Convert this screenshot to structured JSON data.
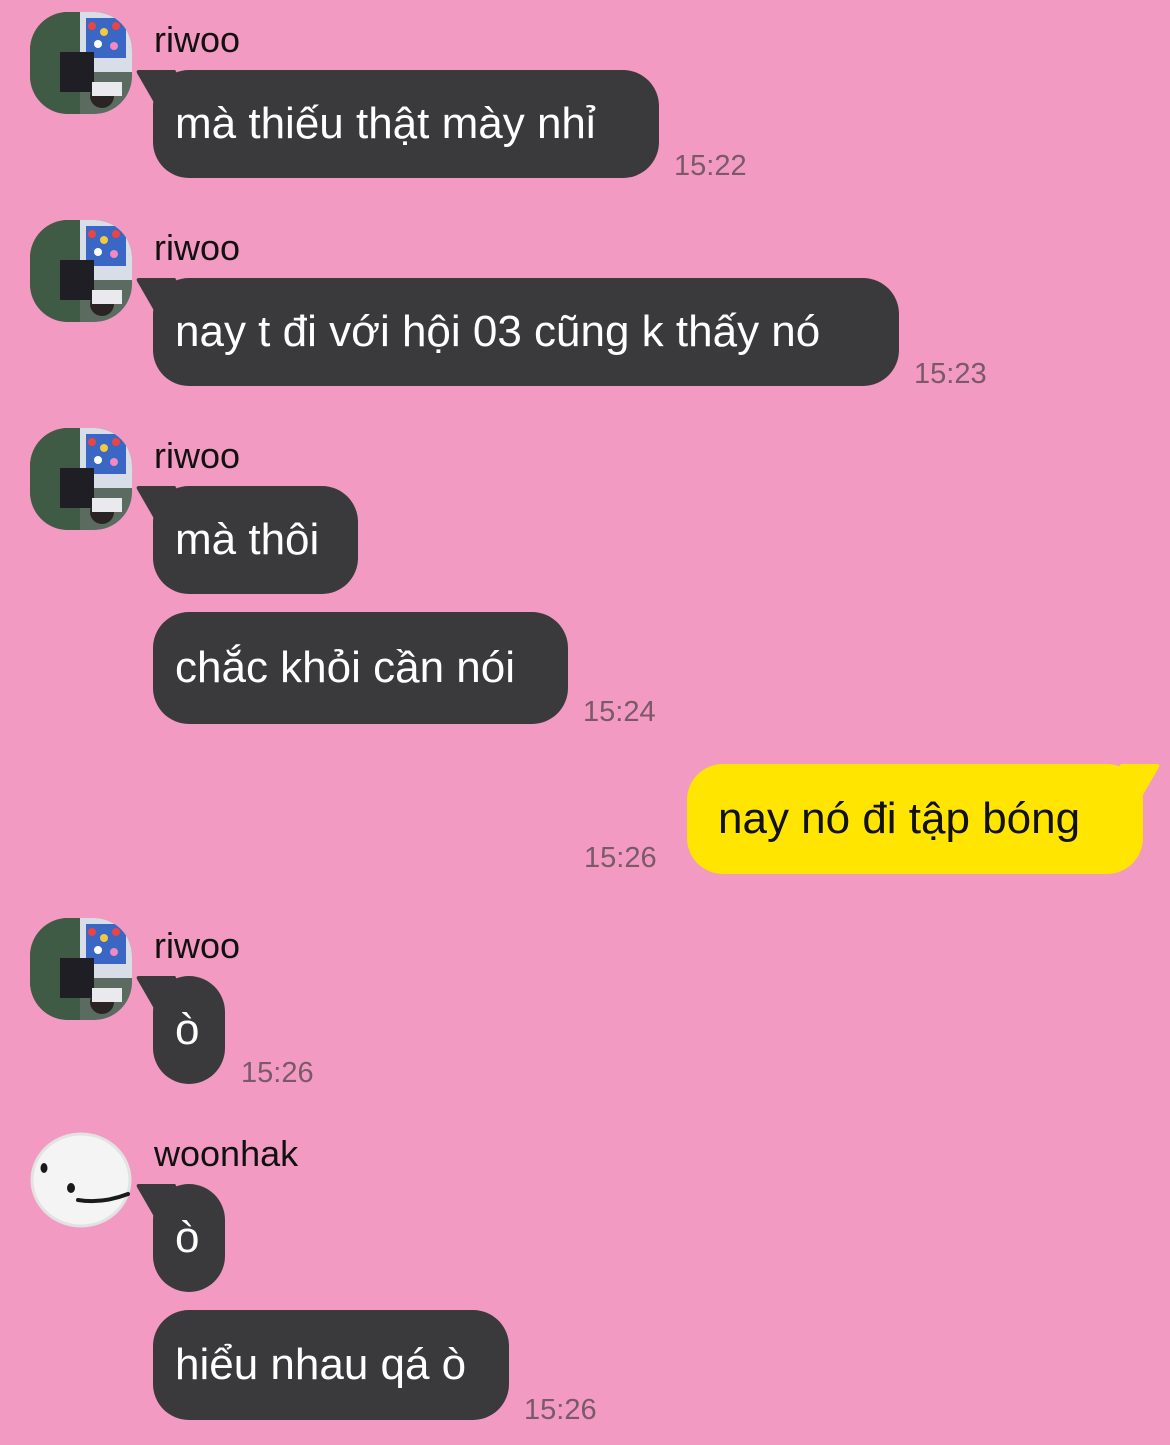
{
  "theme": {
    "background": "#f29ac1",
    "incoming_bubble": "#3a3a3c",
    "outgoing_bubble": "#ffe500",
    "timestamp_color": "#7a5a68"
  },
  "messages": [
    {
      "sender": "riwoo",
      "avatar_icon": "photo-avatar-riwoo",
      "text": "mà thiếu thật mày nhỉ",
      "time": "15:22"
    },
    {
      "sender": "riwoo",
      "avatar_icon": "photo-avatar-riwoo",
      "text": "nay t đi với hội 03 cũng k thấy nó",
      "time": "15:23"
    },
    {
      "sender": "riwoo",
      "avatar_icon": "photo-avatar-riwoo",
      "text": "mà thôi"
    },
    {
      "text": "chắc khỏi cần nói",
      "time": "15:24"
    },
    {
      "outgoing": true,
      "text": "nay nó đi tập bóng",
      "time": "15:26"
    },
    {
      "sender": "riwoo",
      "avatar_icon": "photo-avatar-riwoo",
      "text": "ò",
      "time": "15:26"
    },
    {
      "sender": "woonhak",
      "avatar_icon": "smiley-plush-avatar",
      "text": "ò"
    },
    {
      "text": "hiểu nhau qá ò",
      "time": "15:26"
    }
  ]
}
